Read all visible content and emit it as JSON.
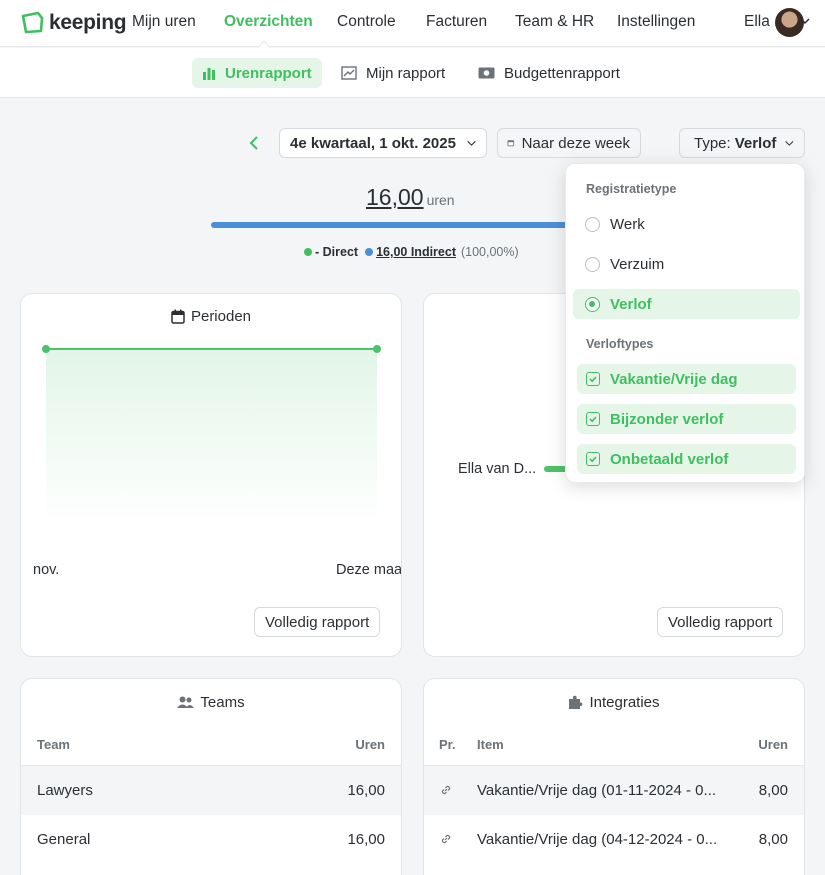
{
  "nav": {
    "logo": "keeping",
    "items": [
      "Mijn uren",
      "Overzichten",
      "Controle",
      "Facturen",
      "Team & HR",
      "Instellingen"
    ],
    "user": "Ella"
  },
  "subnav": {
    "tabs": [
      "Urenrapport",
      "Mijn rapport",
      "Budgettenrapport"
    ]
  },
  "filters": {
    "period": "4e kwartaal, 1 okt. 2025",
    "this_week": "Naar deze week",
    "type_label": "Type:",
    "type_value": "Verlof"
  },
  "summary": {
    "total": "16,00",
    "unit": "uren",
    "direct_label": "- Direct",
    "indirect_value": "16,00 Indirect",
    "indirect_pct": "(100,00%)"
  },
  "periods_card": {
    "title": "Perioden",
    "x_start": "nov.",
    "x_end": "Deze maa",
    "button": "Volledig rapport"
  },
  "people_card": {
    "person": "Ella van D...",
    "button": "Volledig rapport"
  },
  "teams_card": {
    "title": "Teams",
    "col_team": "Team",
    "col_hours": "Uren",
    "rows": [
      {
        "team": "Lawyers",
        "hours": "16,00"
      },
      {
        "team": "General",
        "hours": "16,00"
      }
    ]
  },
  "integrations_card": {
    "title": "Integraties",
    "col_pr": "Pr.",
    "col_item": "Item",
    "col_hours": "Uren",
    "rows": [
      {
        "item": "Vakantie/Vrije dag (01-11-2024 - 0...",
        "hours": "8,00"
      },
      {
        "item": "Vakantie/Vrije dag (04-12-2024 - 0...",
        "hours": "8,00"
      }
    ]
  },
  "type_dropdown": {
    "section1": "Registratietype",
    "options": [
      "Werk",
      "Verzuim",
      "Verlof"
    ],
    "selected": "Verlof",
    "section2": "Verloftypes",
    "leave_types": [
      "Vakantie/Vrije dag",
      "Bijzonder verlof",
      "Onbetaald verlof"
    ]
  },
  "colors": {
    "accent": "#3fbf5f",
    "accent_bg": "#e5f6e9",
    "indirect": "#4a8fd8"
  }
}
